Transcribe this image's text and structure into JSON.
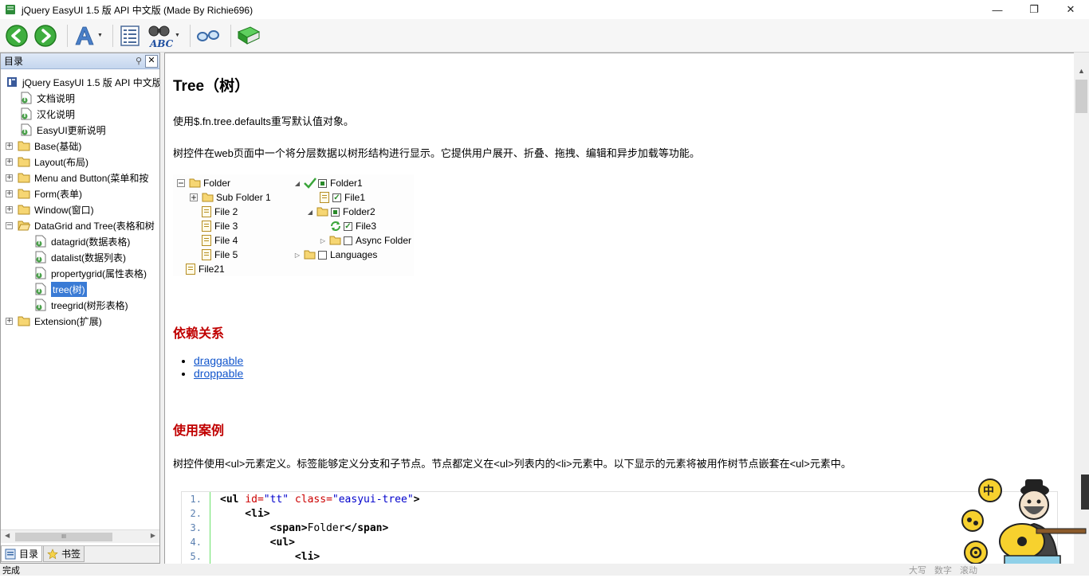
{
  "window": {
    "title": "jQuery EasyUI 1.5 版 API 中文版 (Made By Richie696)",
    "minimize": "—",
    "restore": "❐",
    "close": "✕"
  },
  "toolbar": {
    "buttons": [
      "back",
      "forward",
      "font-size",
      "topics",
      "search",
      "options",
      "bookmark"
    ]
  },
  "sidebar": {
    "header": "目录",
    "items": [
      {
        "label": "jQuery EasyUI 1.5 版 API 中文版",
        "icon": "book-icon",
        "level": 0,
        "expander": ""
      },
      {
        "label": "文档说明",
        "icon": "page-icon",
        "level": 1,
        "expander": ""
      },
      {
        "label": "汉化说明",
        "icon": "page-icon",
        "level": 1,
        "expander": ""
      },
      {
        "label": "EasyUI更新说明",
        "icon": "page-icon",
        "level": 1,
        "expander": ""
      },
      {
        "label": "Base(基础)",
        "icon": "folder-icon",
        "level": 0,
        "expander": "+"
      },
      {
        "label": "Layout(布局)",
        "icon": "folder-icon",
        "level": 0,
        "expander": "+"
      },
      {
        "label": "Menu and Button(菜单和按",
        "icon": "folder-icon",
        "level": 0,
        "expander": "+"
      },
      {
        "label": "Form(表单)",
        "icon": "folder-icon",
        "level": 0,
        "expander": "+"
      },
      {
        "label": "Window(窗口)",
        "icon": "folder-icon",
        "level": 0,
        "expander": "+"
      },
      {
        "label": "DataGrid and Tree(表格和树",
        "icon": "folder-open-icon",
        "level": 0,
        "expander": "−"
      },
      {
        "label": "datagrid(数据表格)",
        "icon": "page-icon",
        "level": 2,
        "expander": ""
      },
      {
        "label": "datalist(数据列表)",
        "icon": "page-icon",
        "level": 2,
        "expander": ""
      },
      {
        "label": "propertygrid(属性表格)",
        "icon": "page-icon",
        "level": 2,
        "expander": ""
      },
      {
        "label": "tree(树)",
        "icon": "page-icon",
        "level": 2,
        "expander": "",
        "selected": true
      },
      {
        "label": "treegrid(树形表格)",
        "icon": "page-icon",
        "level": 2,
        "expander": ""
      },
      {
        "label": "Extension(扩展)",
        "icon": "folder-icon",
        "level": 0,
        "expander": "+"
      }
    ],
    "scroll_thumb": "III",
    "tabs": [
      {
        "label": "目录",
        "active": true
      },
      {
        "label": "书签",
        "active": false
      }
    ]
  },
  "content": {
    "title": "Tree（树）",
    "intro1": "使用$.fn.tree.defaults重写默认值对象。",
    "intro2": "树控件在web页面中一个将分层数据以树形结构进行显示。它提供用户展开、折叠、拖拽、编辑和异步加载等功能。",
    "demo_left": [
      "Folder",
      "Sub Folder 1",
      "File 2",
      "File 3",
      "File 4",
      "File 5",
      "File21"
    ],
    "demo_right": [
      "Folder1",
      "File1",
      "Folder2",
      "File3",
      "Async Folder",
      "Languages"
    ],
    "dep_heading": "依赖关系",
    "deps": [
      "draggable",
      "droppable"
    ],
    "usage_heading": "使用案例",
    "usage_text": "树控件使用<ul>元素定义。标签能够定义分支和子节点。节点都定义在<ul>列表内的<li>元素中。以下显示的元素将被用作树节点嵌套在<ul>元素中。",
    "code_lines": [
      {
        "n": "1.",
        "parts": [
          [
            "kw",
            "<ul "
          ],
          [
            "at",
            "id="
          ],
          [
            "sv",
            "\"tt\""
          ],
          [
            "at",
            " class="
          ],
          [
            "sv",
            "\"easyui-tree\""
          ],
          [
            "kw",
            ">"
          ]
        ]
      },
      {
        "n": "2.",
        "parts": [
          [
            "kw",
            "    <li>"
          ]
        ]
      },
      {
        "n": "3.",
        "parts": [
          [
            "kw",
            "        <span>"
          ],
          [
            "",
            "Folder"
          ],
          [
            "kw",
            "</span>"
          ]
        ]
      },
      {
        "n": "4.",
        "parts": [
          [
            "kw",
            "        <ul>"
          ]
        ]
      },
      {
        "n": "5.",
        "parts": [
          [
            "kw",
            "            <li>"
          ]
        ]
      }
    ]
  },
  "mascot": {
    "badge": "中"
  },
  "statusbar": {
    "status": "完成",
    "indicators": [
      "大写",
      "数字",
      "滚动"
    ]
  },
  "colors": {
    "heading_red": "#c00000",
    "link": "#1155cc",
    "selection": "#3a7bd5"
  }
}
